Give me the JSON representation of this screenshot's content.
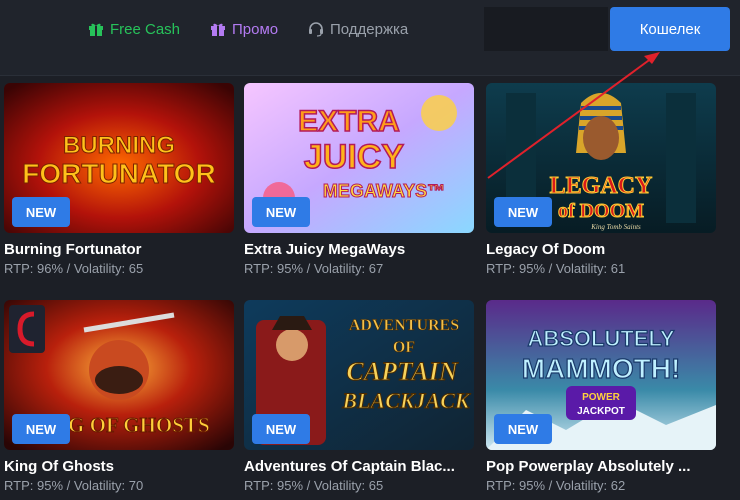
{
  "nav": {
    "free_cash": "Free Cash",
    "promo": "Промо",
    "support": "Поддержка",
    "wallet": "Кошелек"
  },
  "colors": {
    "accent": "#2f7be6",
    "free_cash": "#27c25a",
    "promo": "#b37bf2",
    "muted": "#9aa1ab",
    "annotation_arrow": "#e0212b"
  },
  "games": [
    {
      "title": "Burning Fortunator",
      "meta": "RTP: 96% / Volatility: 65",
      "badge": "NEW",
      "art_line1": "BURNING",
      "art_line2": "FORTUNATOR"
    },
    {
      "title": "Extra Juicy MegaWays",
      "meta": "RTP: 95% / Volatility: 67",
      "badge": "NEW",
      "art_line1": "EXTRA",
      "art_line2": "JUICY",
      "art_line3": "MEGAWAYS™"
    },
    {
      "title": "Legacy Of Doom",
      "meta": "RTP: 95% / Volatility: 61",
      "badge": "NEW",
      "art_line1": "LEGACY",
      "art_line2": "of DOOM",
      "art_line3": "King Tomb Saints"
    },
    {
      "title": "King Of Ghosts",
      "meta": "RTP: 95% / Volatility: 70",
      "badge": "NEW",
      "art_line1": "KING OF GHOSTS"
    },
    {
      "title": "Adventures Of Captain Blac...",
      "meta": "RTP: 95% / Volatility: 65",
      "badge": "NEW",
      "art_line1": "ADVENTURES",
      "art_line2": "OF",
      "art_line3": "CAPTAIN",
      "art_line4": "BLACKJACK"
    },
    {
      "title": "Pop Powerplay Absolutely ...",
      "meta": "RTP: 95% / Volatility: 62",
      "badge": "NEW",
      "art_line1": "ABSOLUTELY",
      "art_line2": "MAMMOTH!",
      "art_line3": "POWER",
      "art_line4": "JACKPOT"
    }
  ]
}
